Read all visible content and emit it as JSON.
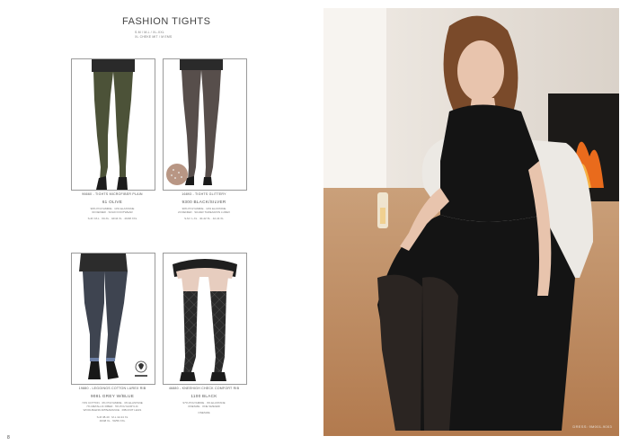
{
  "left_page": {
    "title": "FASHION TIGHTS",
    "subtitle_lines": [
      "S-M / M-L / XL-XXL",
      "XL CHEKE MIT / M EMS"
    ],
    "page_number": "8",
    "products": [
      {
        "title": "96660 - TIGHTS MICROFIBER PLAIN",
        "color": "61 OLIVE",
        "details": [
          "90% POLYAMIDE · 10% ELASTANE",
          "60 DENIER · SOLID FOOTWEAR",
          "S-M / M-L · 60-XL · 42/44 XL · 46/48 XXL"
        ],
        "colors": {
          "leg": "#4c5238",
          "skirt": "#2a2a2a",
          "shoe": "#1c1c1c"
        }
      },
      {
        "title": "16893 - TIGHTS GLITTERY",
        "color": "9300 BLACK/SILVER",
        "details": [
          "90% POLYAMIDE · 10% ELASTANE",
          "20 DENIER · SILVER THREAD/ON LUREX",
          "S-M / L-XL · 40-42 XL · 42-44 XL"
        ],
        "colors": {
          "leg": "#3a2f2b",
          "skirt": "#2a2a2a",
          "shoe": "#1a1a1a"
        }
      },
      {
        "title": "19880 - LEGGINGS COTTON LUREX RIB",
        "color": "9081 GREY W/BLUE",
        "details": [
          "72% COTTON · 3% POLYAMIDE · 3% ELASTANE",
          "7% METALLIC FIBER · 5% POLYACRYLIC",
          "WOOLBLEND APPEARANCE · RIB-KNIT LEGS",
          "S-M 38-40 · M-L 42-44 XL",
          "46/48 XL · 50/56 XXL"
        ],
        "colors": {
          "leg": "#3e4450",
          "skirt": "#2c2c2c",
          "shoe": "#181818"
        }
      },
      {
        "title": "46880 - KNEEHIGH CHECK COMFORT RIB",
        "color": "1100 BLACK",
        "details": [
          "97% POLYAMIDE · 3% ELASTANE",
          "ONESIZE · ONE SIZE/ERI",
          "ONESIZE"
        ],
        "colors": {
          "leg": "#2a2a2a",
          "skin": "#e7cdbf",
          "shoe": "#1c1c1c"
        }
      }
    ]
  },
  "right_page": {
    "dress_note": "DRESS: 9M001-9003",
    "colors": {
      "wall": "#e9e3dc",
      "floor": "#c08a5c",
      "fire": "#e96b1c",
      "dress": "#141414",
      "hair": "#7a4a2a",
      "chair": "#ece9e4"
    }
  }
}
